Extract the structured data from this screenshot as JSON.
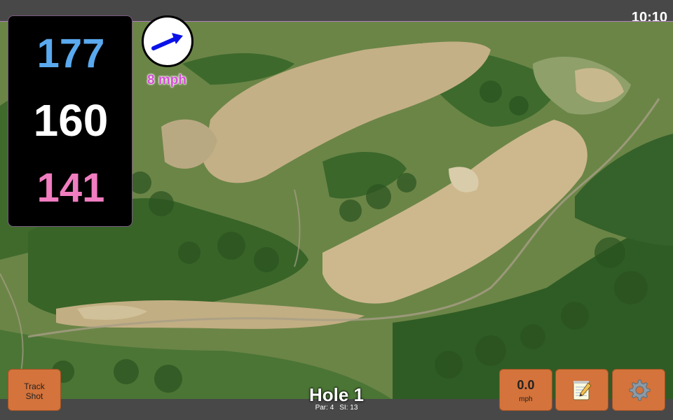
{
  "status_bar": {
    "time": "10:10"
  },
  "distances": {
    "back": "177",
    "middle": "160",
    "front": "141"
  },
  "wind": {
    "speed": "8 mph",
    "icon": "wind-direction-arrow-icon"
  },
  "hole": {
    "title": "Hole 1",
    "par": "Par: 4",
    "si": "SI: 13"
  },
  "buttons": {
    "track_shot": [
      "Track",
      "Shot"
    ],
    "speed_value": "0.0",
    "speed_unit": "mph",
    "notes_icon": "notepad-icon",
    "settings_icon": "gear-icon"
  },
  "colors": {
    "back_distance": "#5aa9ee",
    "middle_distance": "#ffffff",
    "front_distance": "#f07dc0",
    "button": "#d4733b",
    "wind_text": "#d64fd6"
  }
}
